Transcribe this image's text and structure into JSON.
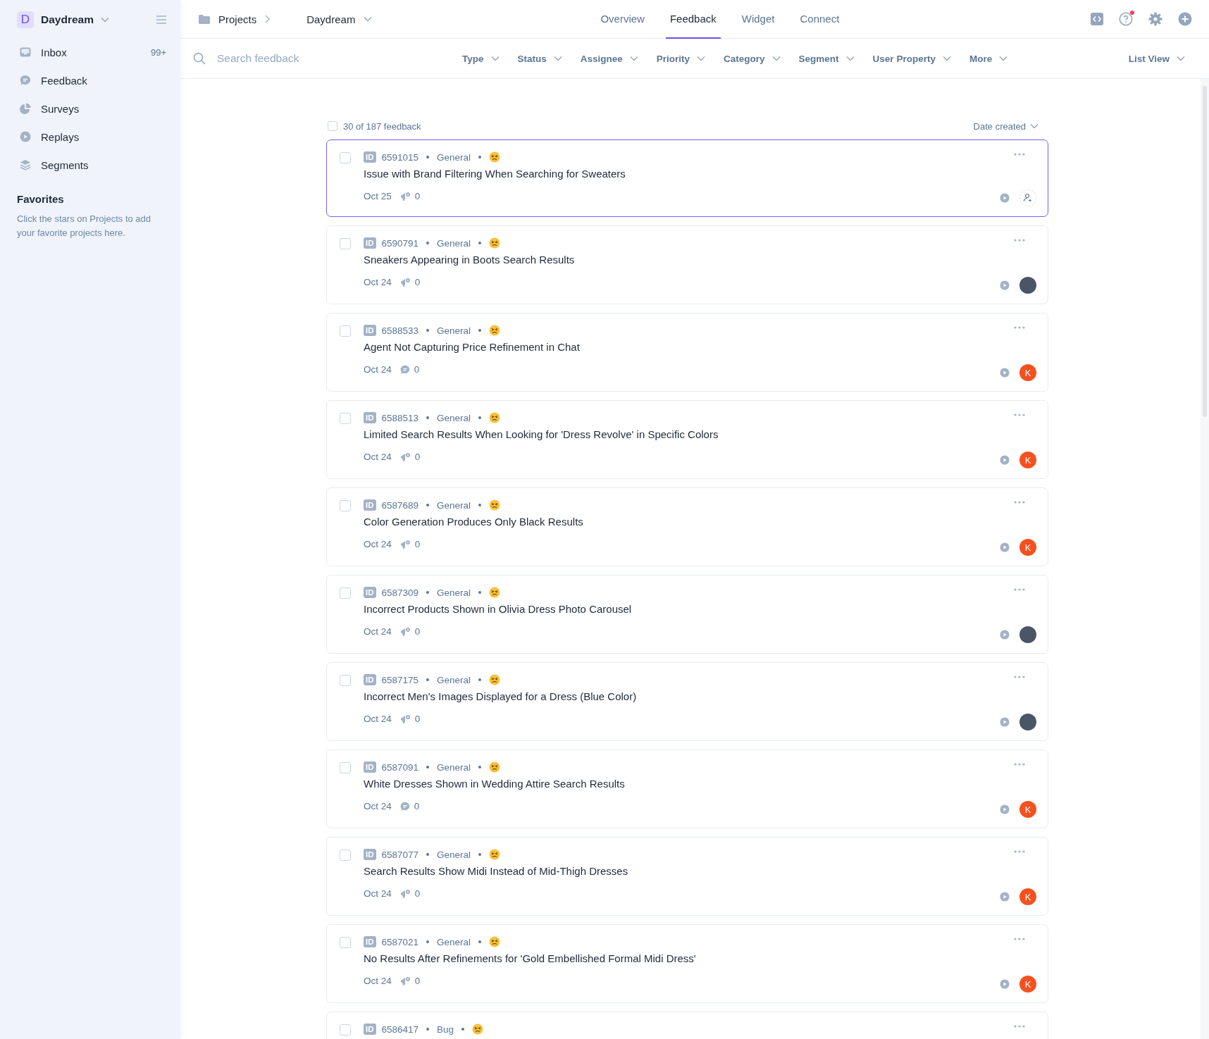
{
  "sidebar": {
    "workspace": {
      "initial": "D",
      "name": "Daydream"
    },
    "items": [
      {
        "label": "Inbox",
        "badge": "99+",
        "kind": "inbox"
      },
      {
        "label": "Feedback",
        "kind": "feedback"
      },
      {
        "label": "Surveys",
        "kind": "surveys"
      },
      {
        "label": "Replays",
        "kind": "replays"
      },
      {
        "label": "Segments",
        "kind": "segments"
      }
    ],
    "favorites": {
      "title": "Favorites",
      "hint": "Click the stars on Projects to add your favorite projects here."
    }
  },
  "breadcrumb": {
    "root": "Projects",
    "project": "Daydream"
  },
  "tabs": [
    {
      "label": "Overview",
      "selected": false
    },
    {
      "label": "Feedback",
      "selected": true
    },
    {
      "label": "Widget",
      "selected": false
    },
    {
      "label": "Connect",
      "selected": false
    }
  ],
  "help_unread": true,
  "search": {
    "placeholder": "Search feedback"
  },
  "filters": [
    "Type",
    "Status",
    "Assignee",
    "Priority",
    "Category",
    "Segment",
    "User Property",
    "More"
  ],
  "view": "List View",
  "list": {
    "select_all_checked": false,
    "count": "30 of 187 feedback",
    "sort": "Date created",
    "items": [
      {
        "id_tag": "ID",
        "id": "6591015",
        "category": "General",
        "title": "Issue with Brand Filtering When Searching for Sweaters",
        "date": "Oct 25",
        "kind": "upvote",
        "count": "0",
        "assignee": {
          "kind": "none"
        },
        "selected": true,
        "checked": false
      },
      {
        "id_tag": "ID",
        "id": "6590791",
        "category": "General",
        "title": "Sneakers Appearing in Boots Search Results",
        "date": "Oct 24",
        "kind": "upvote",
        "count": "0",
        "assignee": {
          "kind": "photo"
        },
        "selected": false,
        "checked": false
      },
      {
        "id_tag": "ID",
        "id": "6588533",
        "category": "General",
        "title": "Agent Not Capturing Price Refinement in Chat",
        "date": "Oct 24",
        "kind": "comment",
        "count": "0",
        "assignee": {
          "kind": "initial",
          "text": "K"
        },
        "selected": false,
        "checked": false
      },
      {
        "id_tag": "ID",
        "id": "6588513",
        "category": "General",
        "title": "Limited Search Results When Looking for 'Dress Revolve' in Specific Colors",
        "date": "Oct 24",
        "kind": "upvote",
        "count": "0",
        "assignee": {
          "kind": "initial",
          "text": "K"
        },
        "selected": false,
        "checked": false
      },
      {
        "id_tag": "ID",
        "id": "6587689",
        "category": "General",
        "title": "Color Generation Produces Only Black Results",
        "date": "Oct 24",
        "kind": "upvote",
        "count": "0",
        "assignee": {
          "kind": "initial",
          "text": "K"
        },
        "selected": false,
        "checked": false
      },
      {
        "id_tag": "ID",
        "id": "6587309",
        "category": "General",
        "title": "Incorrect Products Shown in Olivia Dress Photo Carousel",
        "date": "Oct 24",
        "kind": "upvote",
        "count": "0",
        "assignee": {
          "kind": "photo"
        },
        "selected": false,
        "checked": false
      },
      {
        "id_tag": "ID",
        "id": "6587175",
        "category": "General",
        "title": "Incorrect Men's Images Displayed for a Dress (Blue Color)",
        "date": "Oct 24",
        "kind": "upvote",
        "count": "0",
        "assignee": {
          "kind": "photo"
        },
        "selected": false,
        "checked": false
      },
      {
        "id_tag": "ID",
        "id": "6587091",
        "category": "General",
        "title": "White Dresses Shown in Wedding Attire Search Results",
        "date": "Oct 24",
        "kind": "comment",
        "count": "0",
        "assignee": {
          "kind": "initial",
          "text": "K"
        },
        "selected": false,
        "checked": false
      },
      {
        "id_tag": "ID",
        "id": "6587077",
        "category": "General",
        "title": "Search Results Show Midi Instead of Mid-Thigh Dresses",
        "date": "Oct 24",
        "kind": "upvote",
        "count": "0",
        "assignee": {
          "kind": "initial",
          "text": "K"
        },
        "selected": false,
        "checked": false
      },
      {
        "id_tag": "ID",
        "id": "6587021",
        "category": "General",
        "title": "No Results After Refinements for 'Gold Embellished Formal Midi Dress'",
        "date": "Oct 24",
        "kind": "upvote",
        "count": "0",
        "assignee": {
          "kind": "initial",
          "text": "K"
        },
        "selected": false,
        "checked": false
      },
      {
        "id_tag": "ID",
        "id": "6586417",
        "category": "Bug",
        "selected": false,
        "checked": false
      }
    ]
  }
}
